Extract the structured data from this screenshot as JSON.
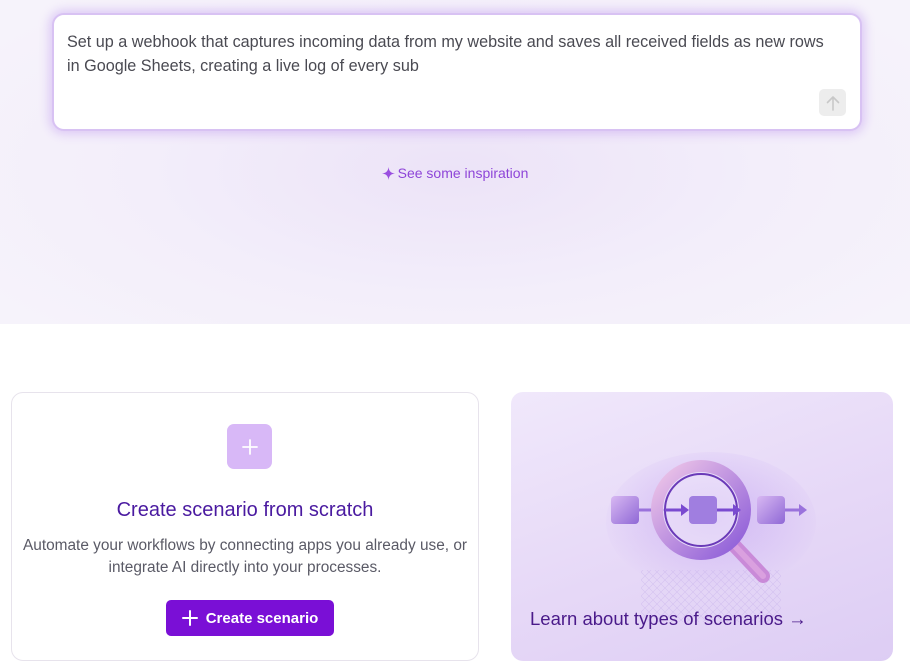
{
  "prompt": {
    "text": "Set up a webhook that captures incoming data from my website and saves all received fields as new rows in Google Sheets, creating a live log of every sub",
    "send_icon": "arrow-up-icon"
  },
  "inspiration": {
    "label": "See some inspiration",
    "icon": "sparkle-icon"
  },
  "scratch_card": {
    "title": "Create scenario from scratch",
    "description": "Automate your workflows by connecting apps you already use, or integrate AI directly into your processes.",
    "button_label": "Create scenario",
    "icon": "plus-icon"
  },
  "learn_card": {
    "link_label": "Learn about types of scenarios →",
    "illustration": "magnifier-flow-illustration"
  },
  "colors": {
    "accent": "#7a0fd6",
    "title": "#4a1aa0",
    "link": "#8e45d8"
  }
}
